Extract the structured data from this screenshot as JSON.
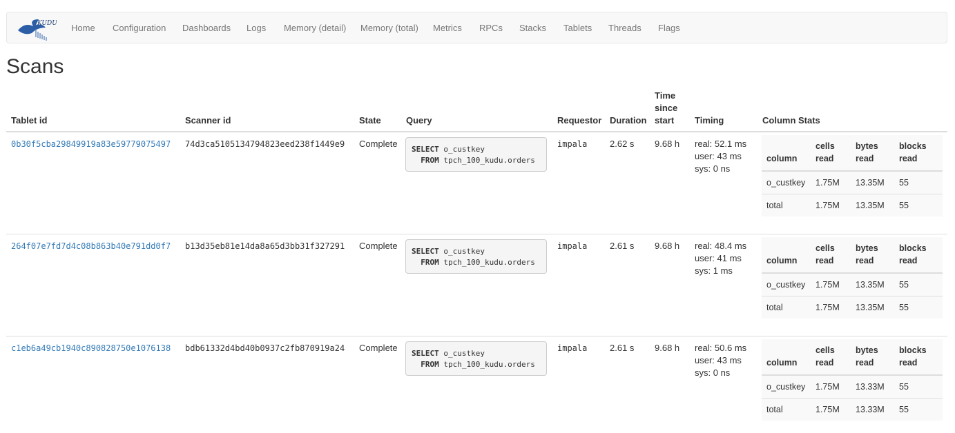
{
  "nav": {
    "brand": "kudu-logo",
    "items": [
      "Home",
      "Configuration",
      "Dashboards",
      "Logs",
      "Memory (detail)",
      "Memory (total)",
      "Metrics",
      "RPCs",
      "Stacks",
      "Tablets",
      "Threads",
      "Flags"
    ]
  },
  "page_title": "Scans",
  "columns": {
    "tablet_id": "Tablet id",
    "scanner_id": "Scanner id",
    "state": "State",
    "query": "Query",
    "requestor": "Requestor",
    "duration": "Duration",
    "time_since_start": [
      "Time",
      "since",
      "start"
    ],
    "timing": "Timing",
    "column_stats": "Column Stats"
  },
  "stats_headers": {
    "column": "column",
    "cells_read": [
      "cells",
      "read"
    ],
    "bytes_read": [
      "bytes",
      "read"
    ],
    "blocks_read": [
      "blocks",
      "read"
    ]
  },
  "query_keywords": {
    "select": "SELECT",
    "from": "FROM"
  },
  "scans": [
    {
      "tablet_id": "0b30f5cba29849919a83e59779075497",
      "scanner_id": "74d3ca5105134794823eed238f1449e9",
      "state": "Complete",
      "query_select": "o_custkey",
      "query_from": "tpch_100_kudu.orders",
      "requestor": "impala",
      "duration": "2.62 s",
      "time_since_start": "9.68 h",
      "timing": [
        "real: 52.1 ms",
        "user: 43 ms",
        "sys: 0 ns"
      ],
      "stats": [
        {
          "column": "o_custkey",
          "cells": "1.75M",
          "bytes": "13.35M",
          "blocks": "55"
        },
        {
          "column": "total",
          "cells": "1.75M",
          "bytes": "13.35M",
          "blocks": "55"
        }
      ]
    },
    {
      "tablet_id": "264f07e7fd7d4c08b863b40e791dd0f7",
      "scanner_id": "b13d35eb81e14da8a65d3bb31f327291",
      "state": "Complete",
      "query_select": "o_custkey",
      "query_from": "tpch_100_kudu.orders",
      "requestor": "impala",
      "duration": "2.61 s",
      "time_since_start": "9.68 h",
      "timing": [
        "real: 48.4 ms",
        "user: 41 ms",
        "sys: 1 ms"
      ],
      "stats": [
        {
          "column": "o_custkey",
          "cells": "1.75M",
          "bytes": "13.35M",
          "blocks": "55"
        },
        {
          "column": "total",
          "cells": "1.75M",
          "bytes": "13.35M",
          "blocks": "55"
        }
      ]
    },
    {
      "tablet_id": "c1eb6a49cb1940c890828750e1076138",
      "scanner_id": "bdb61332d4bd40b0937c2fb870919a24",
      "state": "Complete",
      "query_select": "o_custkey",
      "query_from": "tpch_100_kudu.orders",
      "requestor": "impala",
      "duration": "2.61 s",
      "time_since_start": "9.68 h",
      "timing": [
        "real: 50.6 ms",
        "user: 43 ms",
        "sys: 0 ns"
      ],
      "stats": [
        {
          "column": "o_custkey",
          "cells": "1.75M",
          "bytes": "13.33M",
          "blocks": "55"
        },
        {
          "column": "total",
          "cells": "1.75M",
          "bytes": "13.33M",
          "blocks": "55"
        }
      ]
    }
  ],
  "colors": {
    "link": "#337ab7",
    "navbar_bg": "#f8f8f8",
    "logo": "#2b5ea7"
  }
}
